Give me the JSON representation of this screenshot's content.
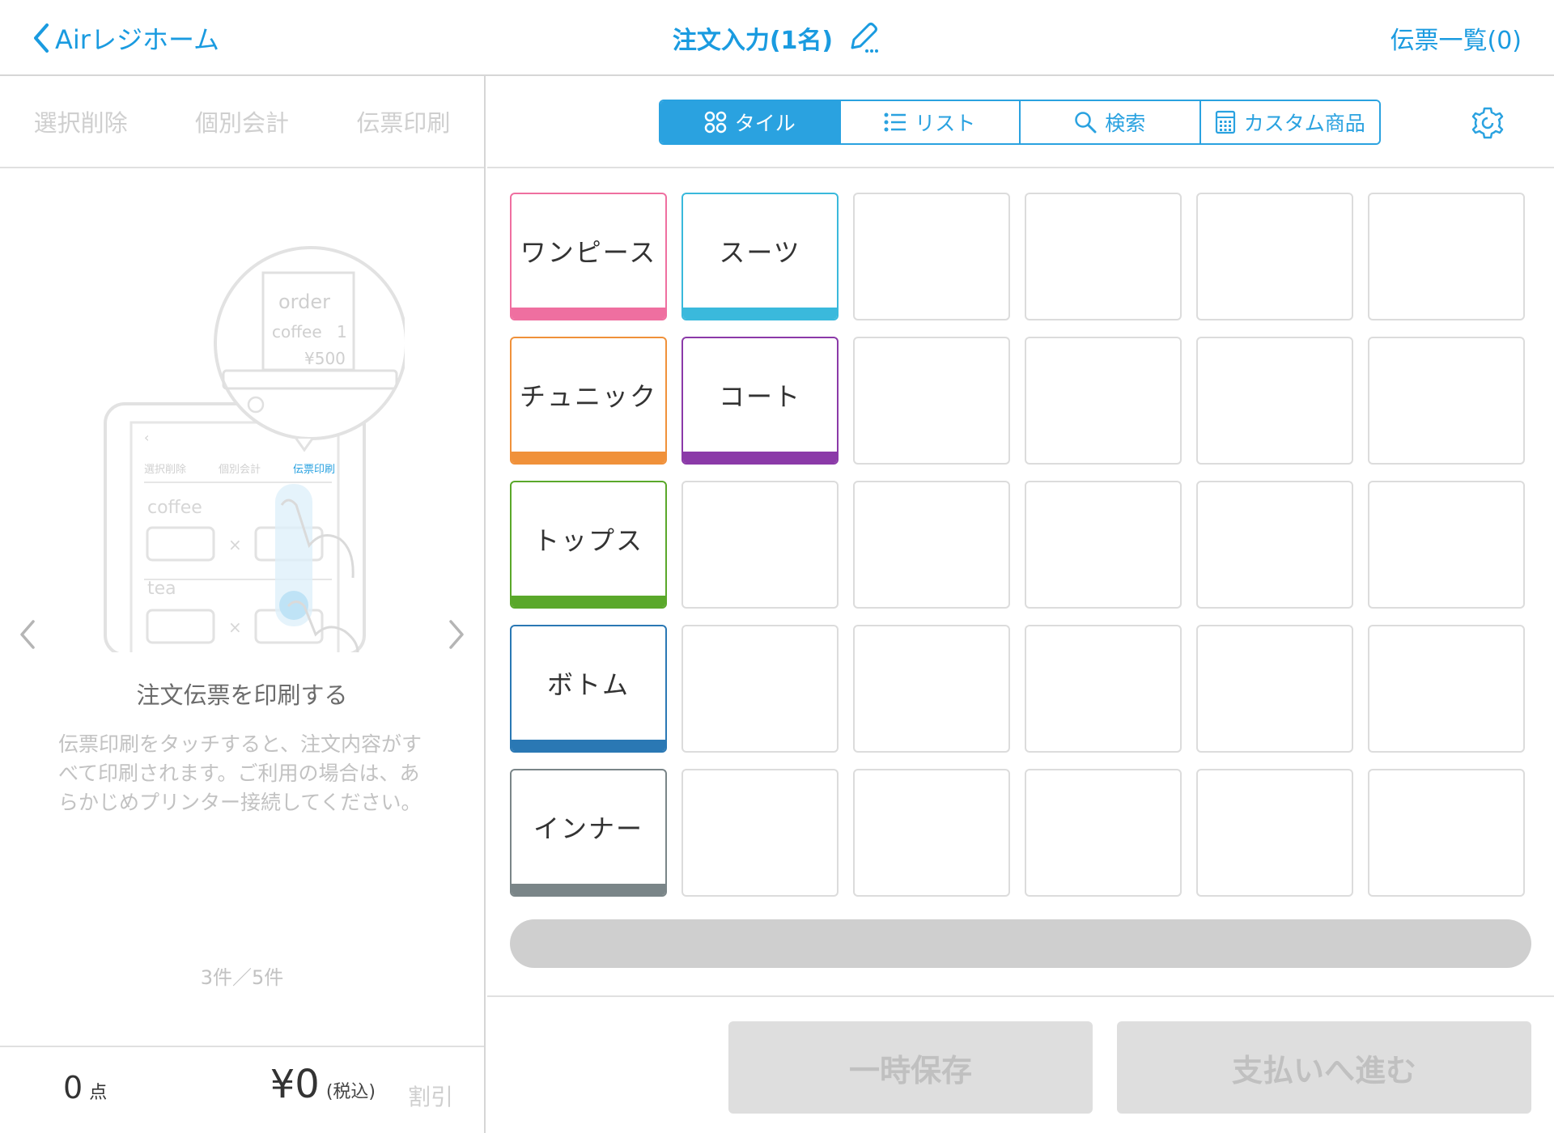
{
  "header": {
    "back_label": "Airレジホーム",
    "title": "注文入力(1名)",
    "slips_label": "伝票一覧(0)"
  },
  "left_actions": [
    "選択削除",
    "個別会計",
    "伝票印刷"
  ],
  "guide": {
    "illustration": {
      "order": "order",
      "coffee": "coffee",
      "qty": "1",
      "price": "¥500",
      "tab1": "選択削除",
      "tab2": "個別会計",
      "tab3": "伝票印刷",
      "item1": "coffee",
      "item2": "tea"
    },
    "title": "注文伝票を印刷する",
    "text": "伝票印刷をタッチすると、注文内容がすべて印刷されます。ご利用の場合は、あらかじめプリンター接続してください。",
    "pager": "3件／5件"
  },
  "totals": {
    "count": "0",
    "count_unit": "点",
    "amount": "¥0",
    "tax_note": "(税込)",
    "discount": "割引"
  },
  "view_modes": [
    {
      "label": "タイル",
      "icon": "tile-icon",
      "active": true
    },
    {
      "label": "リスト",
      "icon": "list-icon",
      "active": false
    },
    {
      "label": "検索",
      "icon": "search-icon",
      "active": false
    },
    {
      "label": "カスタム商品",
      "icon": "calculator-icon",
      "active": false
    }
  ],
  "categories": [
    {
      "label": "ワンピース",
      "color": "#ef6fa0"
    },
    {
      "label": "スーツ",
      "color": "#3ab9dc"
    },
    {
      "label": "チュニック",
      "color": "#f0913a"
    },
    {
      "label": "コート",
      "color": "#8b3aa8"
    },
    {
      "label": "トップス",
      "color": "#5aa82a"
    },
    {
      "label": "ボトム",
      "color": "#2a78b4"
    },
    {
      "label": "インナー",
      "color": "#7a8588"
    }
  ],
  "footer": {
    "hold_label": "一時保存",
    "pay_label": "支払いへ進む"
  }
}
